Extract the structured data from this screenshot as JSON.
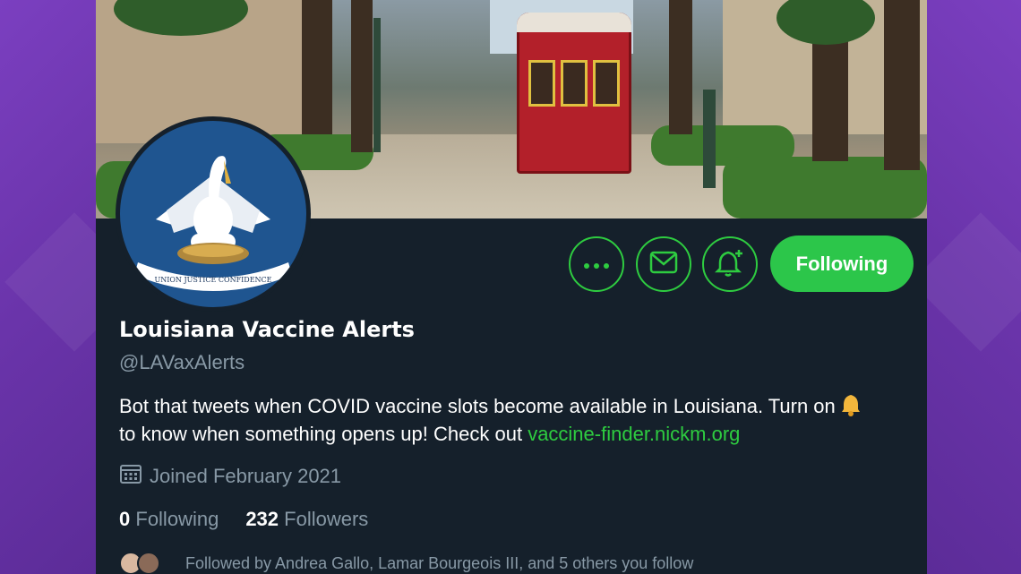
{
  "profile": {
    "name": "Louisiana Vaccine Alerts",
    "handle": "@LAVaxAlerts",
    "bio_text": "Bot that tweets when COVID vaccine slots become available in Louisiana. Turn on",
    "bio_text_2": "to know when something opens up! Check out",
    "bio_link": "vaccine-finder.nickm.org",
    "bio_icon": "bell-icon",
    "joined": "Joined February 2021",
    "following_count": "0",
    "following_label": "Following",
    "followers_count": "232",
    "followers_label": "Followers",
    "followed_by": "Followed by Andrea Gallo, Lamar Bourgeois III, and 5 others you follow",
    "avatar_motto": "UNION JUSTICE CONFIDENCE"
  },
  "actions": {
    "more_icon": "more-icon",
    "message_icon": "envelope-icon",
    "notify_icon": "bell-plus-icon",
    "follow_label": "Following"
  },
  "colors": {
    "background": "#15202b",
    "accent": "#2ecc40",
    "frame": "#6a36a8",
    "secondary_text": "#8899a6"
  }
}
